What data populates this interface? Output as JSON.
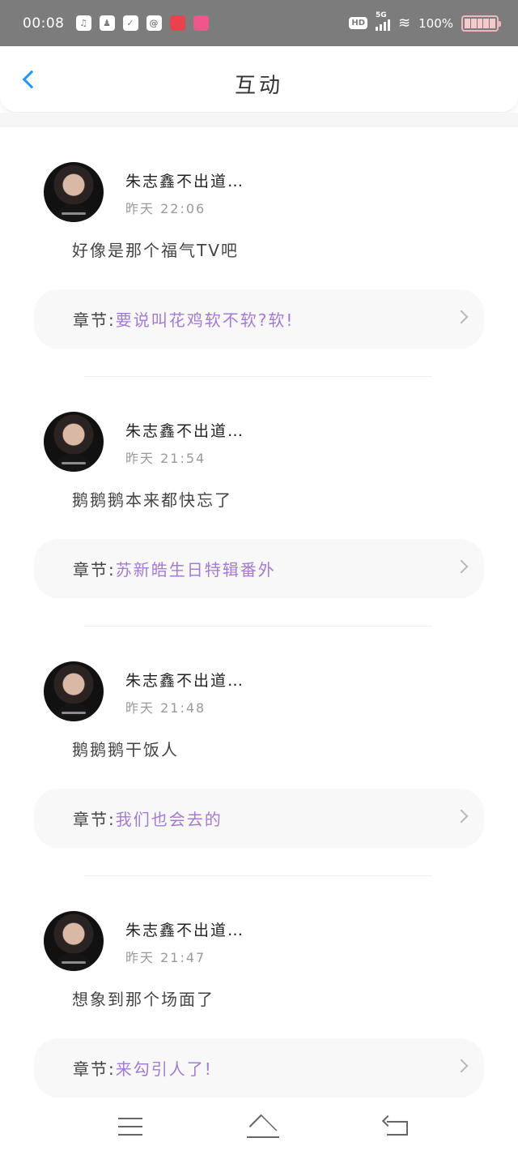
{
  "status_bar": {
    "time": "00:08",
    "network": "5G",
    "hd": "HD",
    "battery_text": "100%",
    "notification_icons": [
      "audio-icon",
      "qq-icon",
      "checkbox-icon",
      "at-icon",
      "app-red-icon",
      "app-pink-icon"
    ]
  },
  "header": {
    "title": "互动",
    "back_icon": "chevron-left-icon"
  },
  "colors": {
    "accent": "#2196f3",
    "chapter_link": "#a47bd2",
    "status_bar_bg": "#7c7c7c"
  },
  "feed": [
    {
      "username": "朱志鑫不出道…",
      "timestamp": "昨天 22:06",
      "comment": "好像是那个福气TV吧",
      "chapter_prefix": "章节:",
      "chapter_title": "要说叫花鸡软不软?软!"
    },
    {
      "username": "朱志鑫不出道…",
      "timestamp": "昨天 21:54",
      "comment": "鹅鹅鹅本来都快忘了",
      "chapter_prefix": "章节:",
      "chapter_title": "苏新皓生日特辑番外"
    },
    {
      "username": "朱志鑫不出道…",
      "timestamp": "昨天 21:48",
      "comment": "鹅鹅鹅干饭人",
      "chapter_prefix": "章节:",
      "chapter_title": "我们也会去的"
    },
    {
      "username": "朱志鑫不出道…",
      "timestamp": "昨天 21:47",
      "comment": "想象到那个场面了",
      "chapter_prefix": "章节:",
      "chapter_title": "来勾引人了!"
    }
  ],
  "nav_bar": {
    "icons": [
      "menu-icon",
      "home-icon",
      "back-icon"
    ]
  }
}
